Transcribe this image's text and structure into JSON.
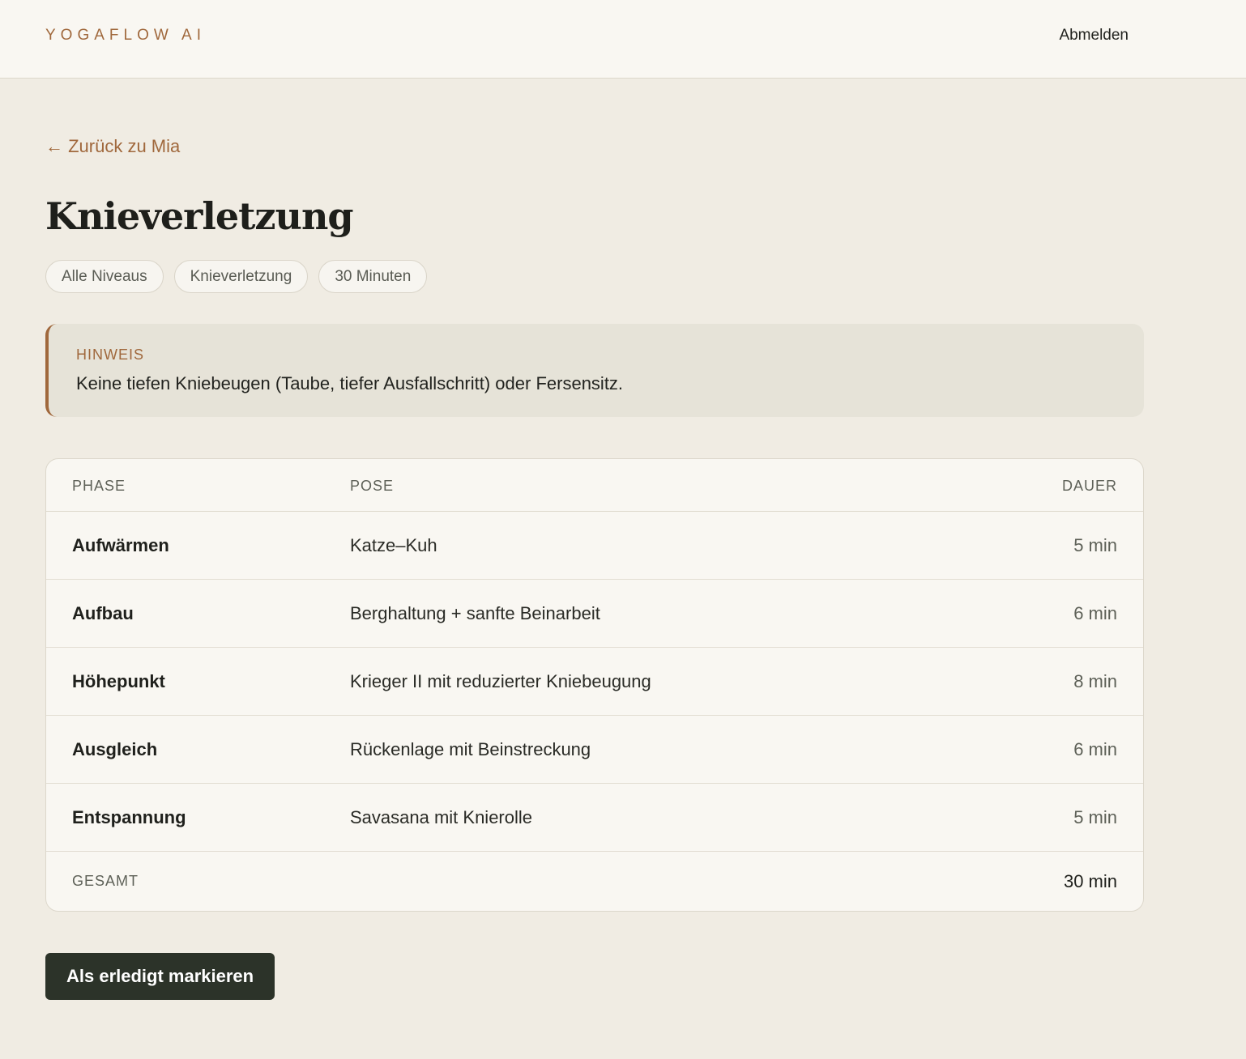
{
  "header": {
    "brand": "YOGAFLOW AI",
    "logout_label": "Abmelden"
  },
  "nav": {
    "back_label": "← Zurück zu Mia"
  },
  "page": {
    "title": "Knieverletzung",
    "tags": [
      "Alle Niveaus",
      "Knieverletzung",
      "30 Minuten"
    ]
  },
  "notice": {
    "label": "HINWEIS",
    "text": "Keine tiefen Kniebeugen (Taube, tiefer Ausfallschritt) oder Fersensitz."
  },
  "table": {
    "headers": {
      "phase": "PHASE",
      "pose": "POSE",
      "duration": "DAUER"
    },
    "rows": [
      {
        "phase": "Aufwärmen",
        "pose": "Katze–Kuh",
        "duration": "5 min"
      },
      {
        "phase": "Aufbau",
        "pose": "Berghaltung + sanfte Beinarbeit",
        "duration": "6 min"
      },
      {
        "phase": "Höhepunkt",
        "pose": "Krieger II mit reduzierter Kniebeugung",
        "duration": "8 min"
      },
      {
        "phase": "Ausgleich",
        "pose": "Rückenlage mit Beinstreckung",
        "duration": "6 min"
      },
      {
        "phase": "Entspannung",
        "pose": "Savasana mit Knierolle",
        "duration": "5 min"
      }
    ],
    "total_label": "GESAMT",
    "total_value": "30 min"
  },
  "actions": {
    "done_label": "Als erledigt markieren"
  },
  "colors": {
    "accent": "#a0683c",
    "background": "#f0ece3",
    "surface": "#f9f7f2",
    "button": "#2c3329"
  }
}
